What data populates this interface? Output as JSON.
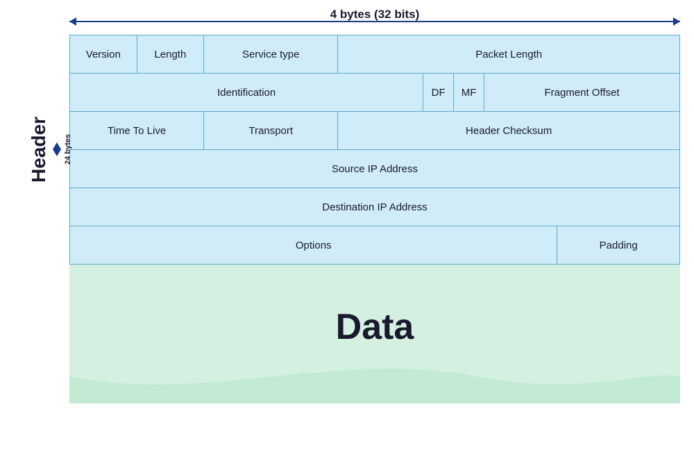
{
  "diagram": {
    "top_label": "4 bytes (32 bits)",
    "header_label": "Header",
    "bytes_label": "24 bytes",
    "rows": [
      {
        "cells": [
          {
            "label": "Version",
            "class": "cell-version"
          },
          {
            "label": "Length",
            "class": "cell-length"
          },
          {
            "label": "Service type",
            "class": "cell-service"
          },
          {
            "label": "Packet Length",
            "class": "cell-packet-length"
          }
        ]
      },
      {
        "cells": [
          {
            "label": "Identification",
            "class": "cell-identification"
          },
          {
            "label": "DF",
            "class": "cell-df"
          },
          {
            "label": "MF",
            "class": "cell-mf"
          },
          {
            "label": "Fragment Offset",
            "class": "cell-fragment"
          }
        ]
      },
      {
        "cells": [
          {
            "label": "Time To Live",
            "class": "cell-ttl"
          },
          {
            "label": "Transport",
            "class": "cell-transport"
          },
          {
            "label": "Header Checksum",
            "class": "cell-header-checksum"
          }
        ]
      },
      {
        "cells": [
          {
            "label": "Source IP Address",
            "class": "cell-full"
          }
        ]
      },
      {
        "cells": [
          {
            "label": "Destination IP Address",
            "class": "cell-full"
          }
        ]
      },
      {
        "cells": [
          {
            "label": "Options",
            "class": "cell-options"
          },
          {
            "label": "Padding",
            "class": "cell-padding"
          }
        ]
      }
    ],
    "data_label": "Data"
  }
}
